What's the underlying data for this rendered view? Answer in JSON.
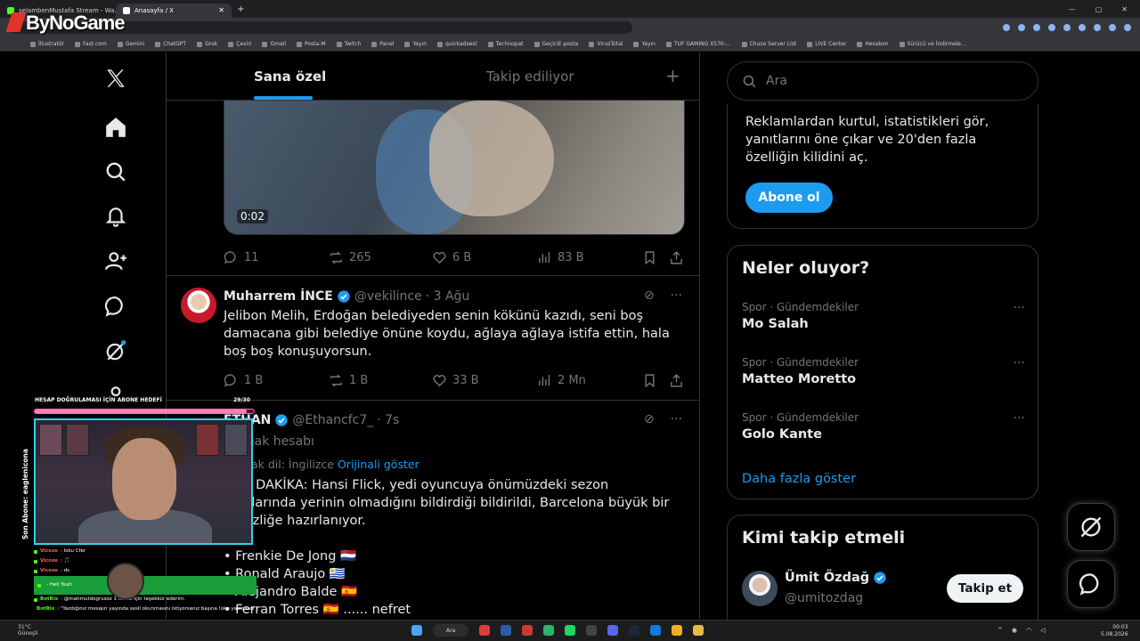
{
  "browser": {
    "tabs": [
      {
        "title": "selambenMustafa Stream - Wa..."
      },
      {
        "title": "Anasayfa / X"
      }
    ],
    "bookmarks": [
      "İllustratör",
      "Fast.com",
      "Gemini",
      "ChatGPT",
      "Grok",
      "Çeviri",
      "Gmail",
      "Posta-M",
      "Twitch",
      "Panel",
      "Yayın",
      "quickadsest",
      "Technopat",
      "GeçiciE-posta",
      "VirusTotal",
      "Yayın",
      "TUF GAMING X570-...",
      "Chuze Server List",
      "LIVE Center",
      "Hesabım",
      "Sürücü ve İndirmele..."
    ],
    "brand": "ByNoGame"
  },
  "feed": {
    "tab_for_you": "Sana özel",
    "tab_following": "Takip ediliyor",
    "tab_plus": "+",
    "video_duration": "0:02",
    "tweet1_actions": {
      "replies": "11",
      "reposts": "265",
      "likes": "6 B",
      "views": "83 B"
    },
    "tweet2": {
      "name": "Muharrem İNCE",
      "handle": "@vekilince",
      "time": "· 3 Ağu",
      "text": "Jelibon Melih, Erdoğan belediyeden senin kökünü kazıdı, seni boş damacana gibi belediye önüne koydu, ağlaya ağlaya istifa ettin, hala boş boş konuşuyorsun.",
      "replies": "1 B",
      "reposts": "1 B",
      "likes": "33 B",
      "views": "2 Mn"
    },
    "tweet3": {
      "name": "ETHAN",
      "handle": "@Ethancfc7_",
      "time": "· 7s",
      "account_type": "Kaynak hesabı",
      "source_lang": "Kaynak dil: İngilizce",
      "show_original": "Orijinali göster",
      "text": "SON DAKİKA: Hansi Flick, yedi oyuncuya önümüzdeki sezon planlarında yerinin olmadığını bildirdiği bildirildi, Barcelona büyük bir temizliğe hazırlanıyor.",
      "players": [
        "• Frenkie De Jong 🇳🇱",
        "• Ronald Araujo 🇺🇾",
        "• Alejandro Balde 🇪🇸",
        "• Ferran Torres 🇪🇸 ...... nefret"
      ]
    }
  },
  "sidebar": {
    "search_placeholder": "Ara",
    "premium_text": "Reklamlardan kurtul, istatistikleri gör, yanıtlarını öne çıkar ve 20'den fazla özelliğin kilidini aç.",
    "premium_button": "Abone ol",
    "trends_title": "Neler oluyor?",
    "trends": [
      {
        "category": "Spor · Gündemdekiler",
        "name": "Mo Salah"
      },
      {
        "category": "Spor · Gündemdekiler",
        "name": "Matteo Moretto"
      },
      {
        "category": "Spor · Gündemdekiler",
        "name": "Golo Kante"
      }
    ],
    "show_more": "Daha fazla göster",
    "follow_title": "Kimi takip etmeli",
    "follow_name": "Ümit Özdağ",
    "follow_handle": "@umitozdag",
    "follow_button": "Takip et"
  },
  "stream": {
    "goal_title": "HESAP DOĞRULAMASI İÇİN ABONE HEDEFİ",
    "goal_count": "29/30",
    "goal_fraction": 0.967,
    "last_sub": "Son Abone: eaglenicona",
    "chat": [
      {
        "user": "Vicoze",
        "msg": ": loku Cfer"
      },
      {
        "user": "Vicoze",
        "msg": ": 🎵"
      },
      {
        "user": "Vicoze",
        "msg": ": ds"
      },
      {
        "user": "",
        "msg": "- Hell Yeah"
      },
      {
        "user": "BotRix",
        "msg": ": @mahmutdogrusoz 1 KICKs için teşekkür ederim."
      },
      {
        "user": "BotRix",
        "msg": ": \"Yazdığınız mesajın yayında sesli okunmasını istiyorsanız başına !oku yazmanız yeterli!\""
      }
    ]
  },
  "taskbar": {
    "weather": "31°C",
    "weather_sub": "Güneşli",
    "search": "Ara",
    "time": "00:03",
    "date": "5.08.2026"
  },
  "colors": {
    "accent": "#1d9bf0",
    "kick_green": "#53fc18",
    "background": "#000000"
  }
}
